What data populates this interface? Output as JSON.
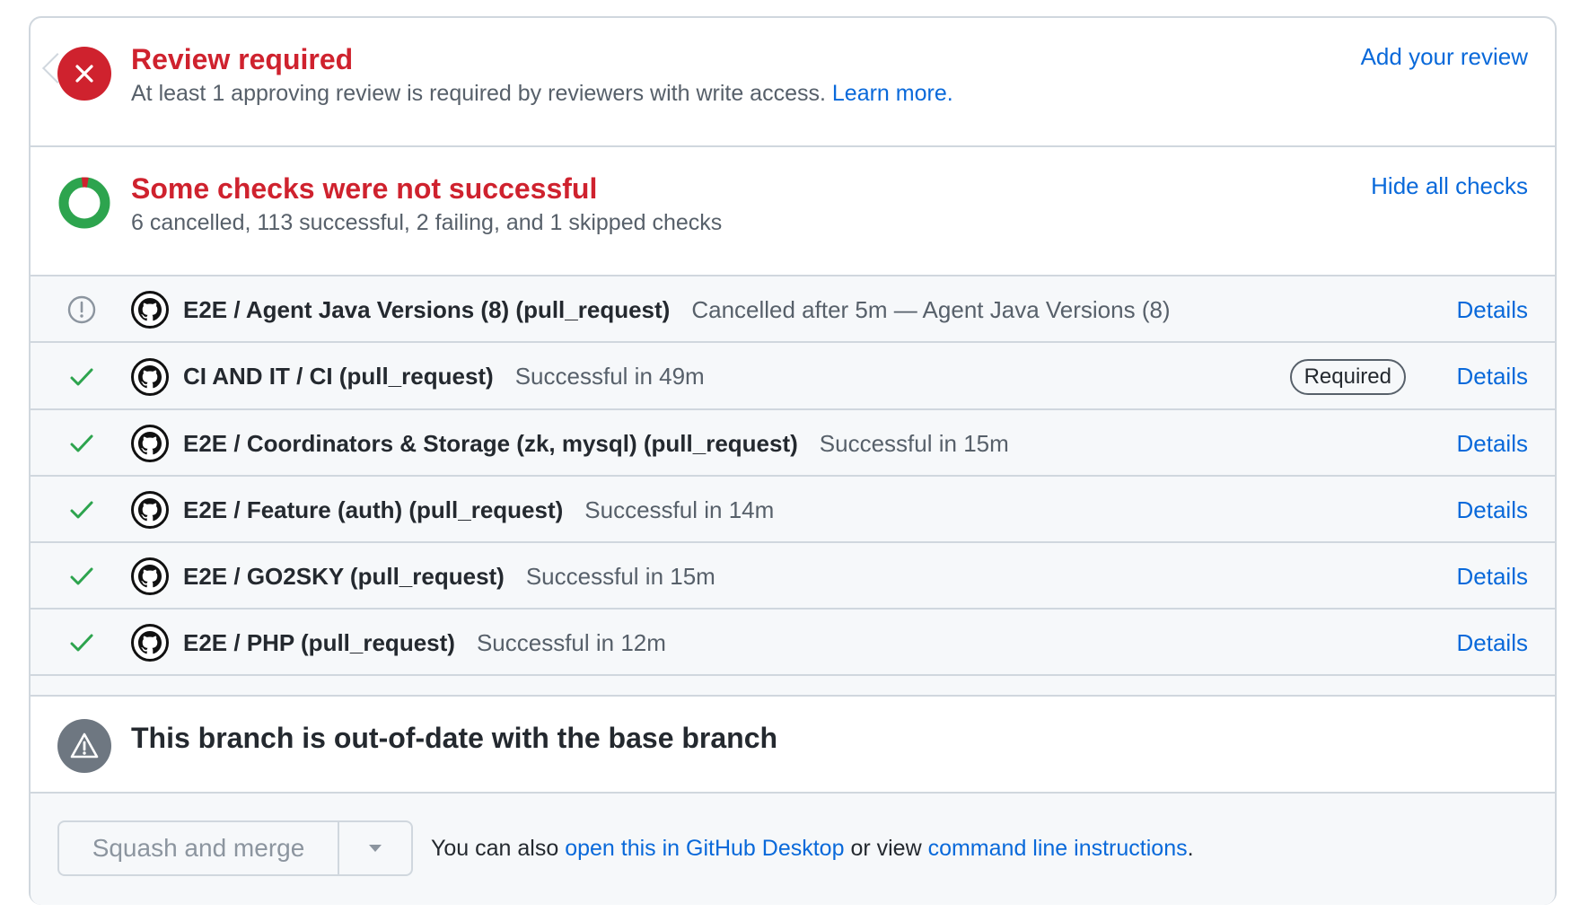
{
  "review": {
    "title": "Review required",
    "description": "At least 1 approving review is required by reviewers with write access.",
    "learn_more": "Learn more.",
    "add_review": "Add your review",
    "color": "#cf222e"
  },
  "checks": {
    "title": "Some checks were not successful",
    "summary": "6 cancelled, 113 successful, 2 failing, and 1 skipped checks",
    "toggle": "Hide all checks",
    "counts": {
      "cancelled": 6,
      "successful": 113,
      "failing": 2,
      "skipped": 1
    },
    "colors": {
      "success": "#2da44e",
      "failure": "#cf222e",
      "neutral": "#6e7781"
    }
  },
  "check_rows": [
    {
      "status": "cancelled",
      "status_icon": "alert-circle-icon",
      "name": "E2E / Agent Java Versions (8) (pull_request)",
      "description": "Cancelled after 5m — Agent Java Versions (8)",
      "required": false,
      "details": "Details"
    },
    {
      "status": "success",
      "status_icon": "check-icon",
      "name": "CI AND IT / CI (pull_request)",
      "description": "Successful in 49m",
      "required": true,
      "required_label": "Required",
      "details": "Details"
    },
    {
      "status": "success",
      "status_icon": "check-icon",
      "name": "E2E / Coordinators & Storage (zk, mysql) (pull_request)",
      "description": "Successful in 15m",
      "required": false,
      "details": "Details"
    },
    {
      "status": "success",
      "status_icon": "check-icon",
      "name": "E2E / Feature (auth) (pull_request)",
      "description": "Successful in 14m",
      "required": false,
      "details": "Details"
    },
    {
      "status": "success",
      "status_icon": "check-icon",
      "name": "E2E / GO2SKY (pull_request)",
      "description": "Successful in 15m",
      "required": false,
      "details": "Details"
    },
    {
      "status": "success",
      "status_icon": "check-icon",
      "name": "E2E / PHP (pull_request)",
      "description": "Successful in 12m",
      "required": false,
      "details": "Details"
    }
  ],
  "branch": {
    "title": "This branch is out-of-date with the base branch"
  },
  "merge": {
    "button_label": "Squash and merge",
    "text_prefix": "You can also",
    "desktop_link": "open this in GitHub Desktop",
    "text_middle": "or view",
    "cli_link": "command line instructions",
    "text_suffix": "."
  }
}
